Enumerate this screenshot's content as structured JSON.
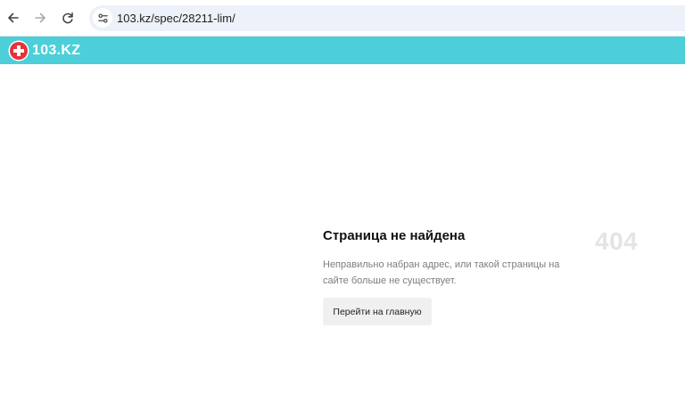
{
  "browser": {
    "back_icon": "arrow-left-icon",
    "forward_icon": "arrow-right-icon",
    "reload_icon": "reload-icon",
    "site_info_icon": "tune-icon",
    "url": "103.kz/spec/28211-lim/"
  },
  "header": {
    "logo_text": "103.KZ",
    "logo_icon": "medical-cross-icon",
    "background": "#4ccfd8",
    "accent": "#e5333a"
  },
  "error": {
    "title": "Страница не найдена",
    "code": "404",
    "description": "Неправильно набран адрес, или такой страницы на сайте больше не существует.",
    "button_label": "Перейти на главную"
  }
}
